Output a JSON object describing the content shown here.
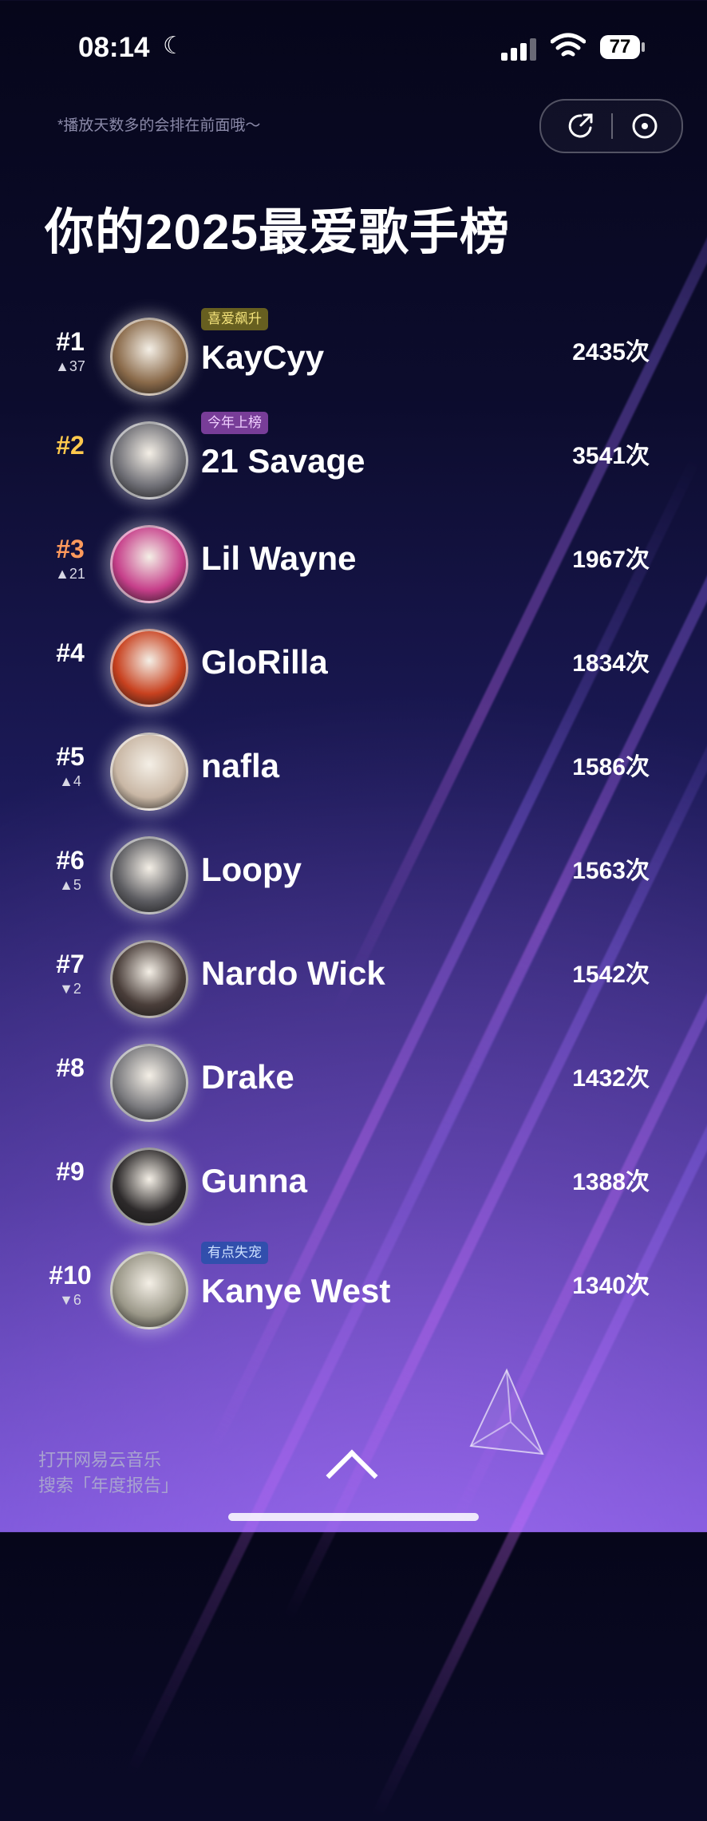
{
  "status_bar": {
    "time": "08:14",
    "battery": "77"
  },
  "header": {
    "hint": "*播放天数多的会排在前面哦～",
    "title": "你的2025最爱歌手榜"
  },
  "artists": [
    {
      "rank": "#1",
      "delta": "▲37",
      "badge": "喜爱飙升",
      "name": "KayCyy",
      "count": "2435次",
      "color": "#8a6a4a"
    },
    {
      "rank": "#2",
      "delta": "",
      "badge": "今年上榜",
      "name": "21 Savage",
      "count": "3541次",
      "color": "#6f6f76"
    },
    {
      "rank": "#3",
      "delta": "▲21",
      "badge": "",
      "name": "Lil Wayne",
      "count": "1967次",
      "color": "#c63f8a"
    },
    {
      "rank": "#4",
      "delta": "",
      "badge": "",
      "name": "GloRilla",
      "count": "1834次",
      "color": "#c8411f"
    },
    {
      "rank": "#5",
      "delta": "▲4",
      "badge": "",
      "name": "nafla",
      "count": "1586次",
      "color": "#c9b7a5"
    },
    {
      "rank": "#6",
      "delta": "▲5",
      "badge": "",
      "name": "Loopy",
      "count": "1563次",
      "color": "#5c5c61"
    },
    {
      "rank": "#7",
      "delta": "▼2",
      "badge": "",
      "name": "Nardo Wick",
      "count": "1542次",
      "color": "#4a3e3a"
    },
    {
      "rank": "#8",
      "delta": "",
      "badge": "",
      "name": "Drake",
      "count": "1432次",
      "color": "#7a7a7e"
    },
    {
      "rank": "#9",
      "delta": "",
      "badge": "",
      "name": "Gunna",
      "count": "1388次",
      "color": "#2d2a2b"
    },
    {
      "rank": "#10",
      "delta": "▼6",
      "badge": "有点失宠",
      "name": "Kanye West",
      "count": "1340次",
      "color": "#9a9788"
    }
  ],
  "footer": {
    "line1": "打开网易云音乐",
    "line2": "搜索「年度报告」"
  }
}
